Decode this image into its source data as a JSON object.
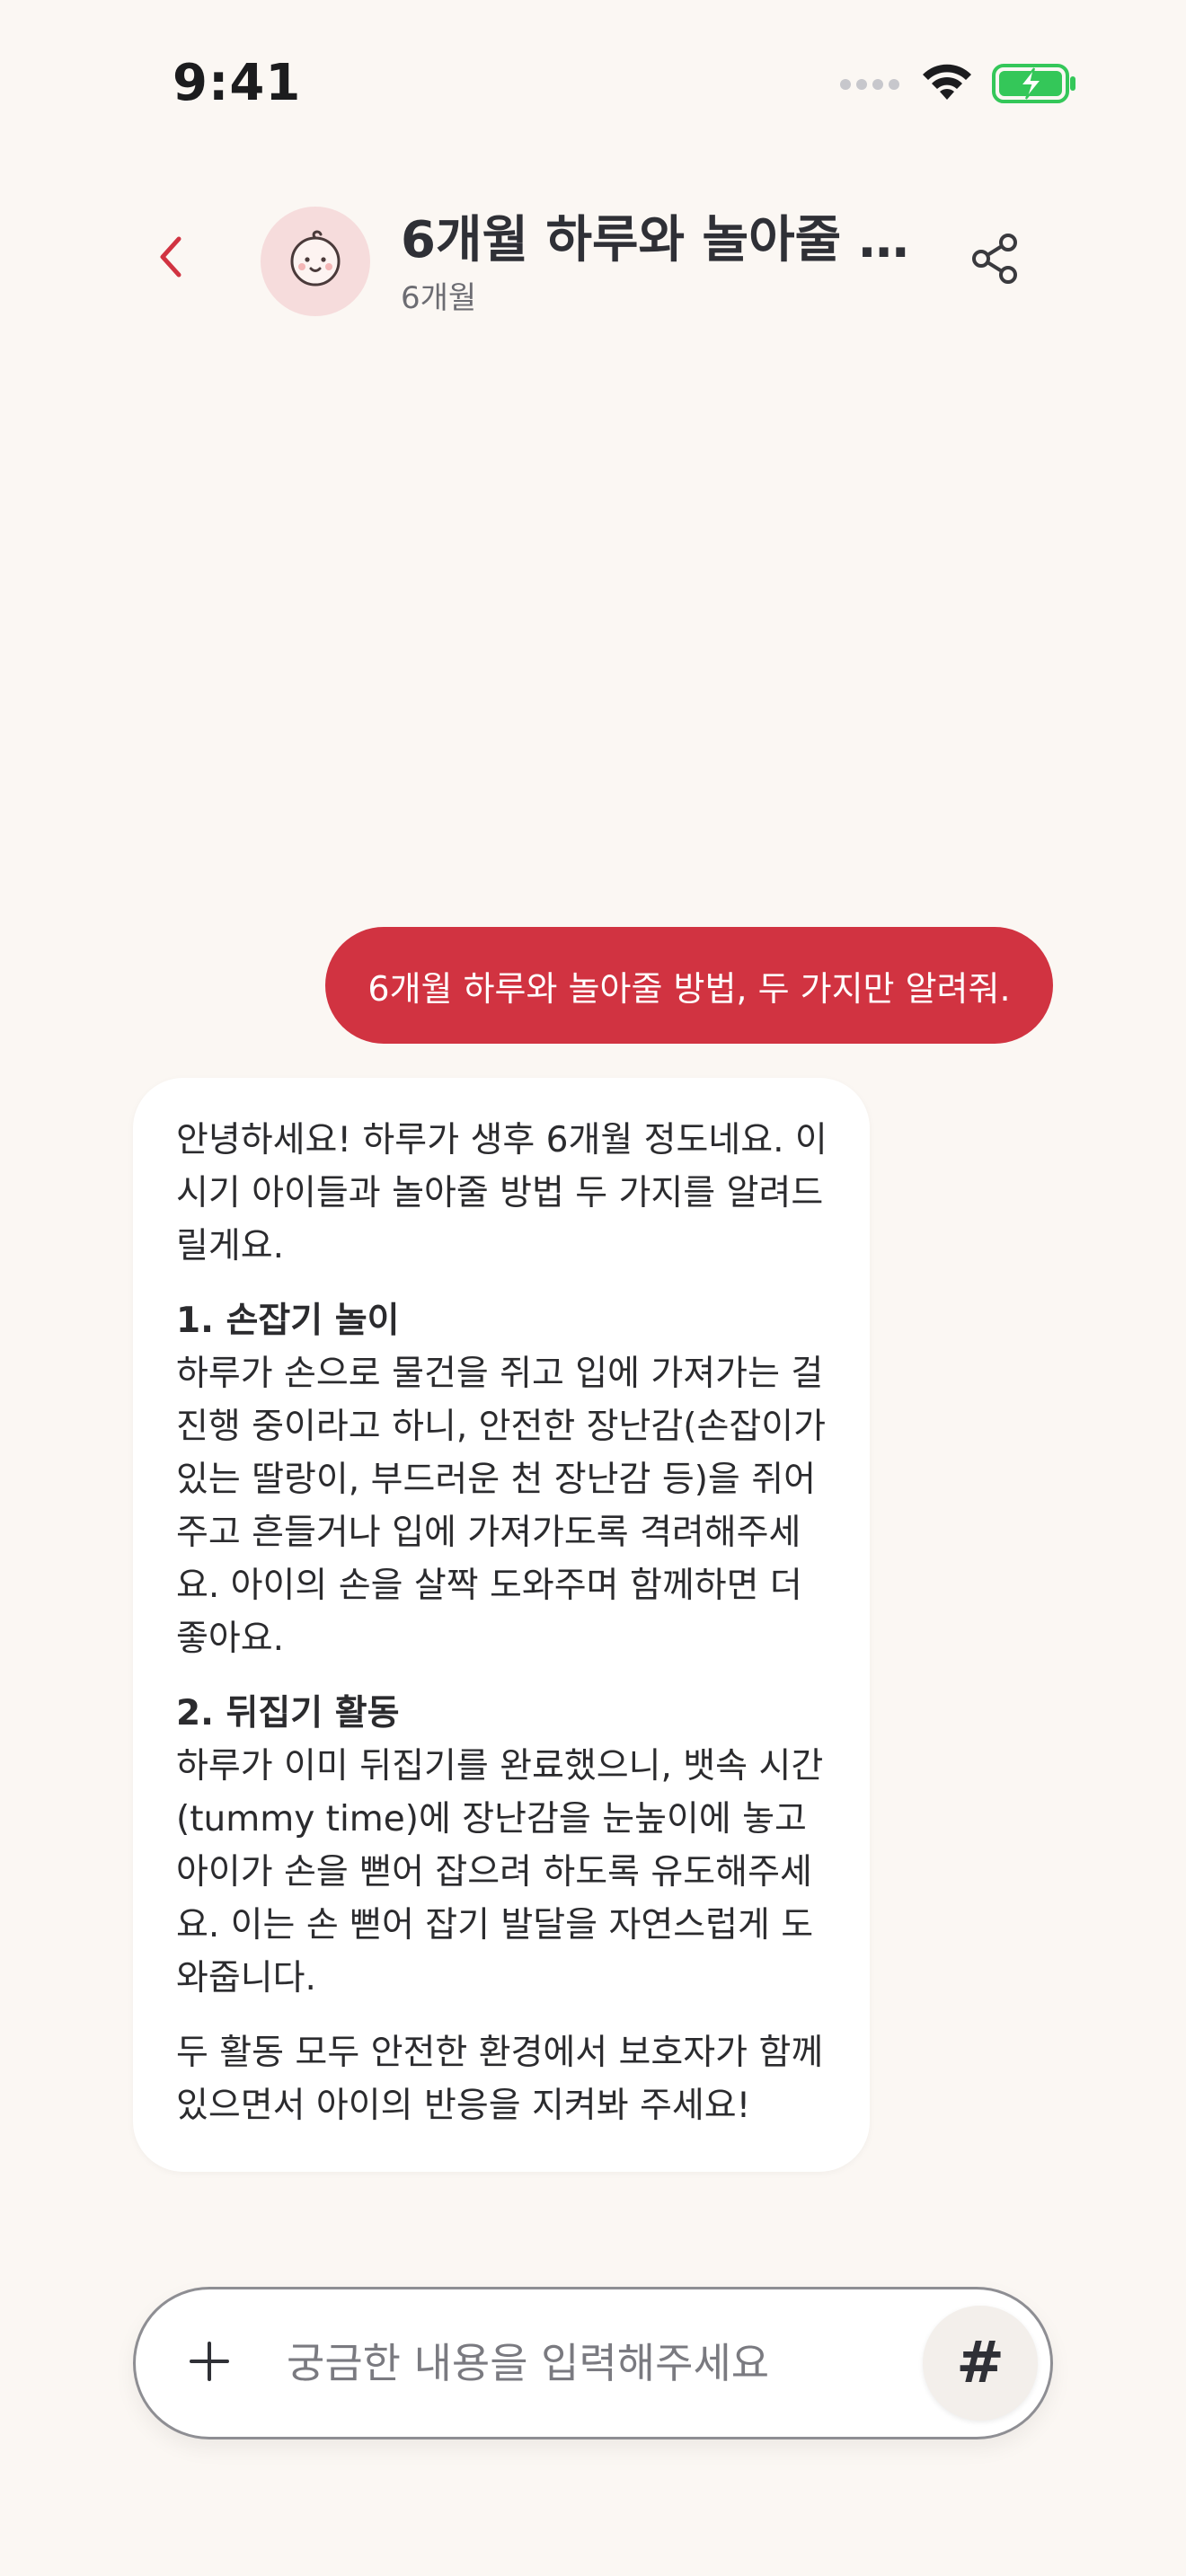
{
  "status_bar": {
    "time": "9:41"
  },
  "header": {
    "title": "6개월 하루와 놀아줄 …",
    "subtitle": "6개월"
  },
  "messages": {
    "user": "6개월 하루와 놀아줄 방법, 두 가지만 알려줘.",
    "ai": {
      "intro": "안녕하세요! 하루가 생후 6개월 정도네요. 이 시기 아이들과 놀아줄 방법 두 가지를 알려드릴게요.",
      "section1_title": "1. 손잡기 놀이",
      "section1_body": "하루가 손으로 물건을 쥐고 입에 가져가는 걸 진행 중이라고 하니, 안전한 장난감(손잡이가 있는 딸랑이, 부드러운 천 장난감 등)을 쥐어 주고 흔들거나 입에 가져가도록 격려해주세요. 아이의 손을 살짝 도와주며 함께하면 더 좋아요.",
      "section2_title": "2. 뒤집기 활동",
      "section2_body": "하루가 이미 뒤집기를 완료했으니, 뱃속 시간(tummy time)에 장난감을 눈높이에 놓고 아이가 손을 뻗어 잡으려 하도록 유도해주세요. 이는 손 뻗어 잡기 발달을 자연스럽게 도와줍니다.",
      "closing": "두 활동 모두 안전한 환경에서 보호자가 함께 있으면서 아이의 반응을 지켜봐 주세요!"
    }
  },
  "input": {
    "placeholder": "궁금한 내용을 입력해주세요",
    "value": "",
    "hashtag_label": "#"
  },
  "icons": {
    "back": "chevron-left-icon",
    "share": "share-icon",
    "avatar": "baby-face-icon",
    "plus": "plus-icon"
  },
  "colors": {
    "accent": "#D13341",
    "background": "#FBF7F3",
    "avatar_bg": "#F6DCDC",
    "battery": "#34C759"
  }
}
